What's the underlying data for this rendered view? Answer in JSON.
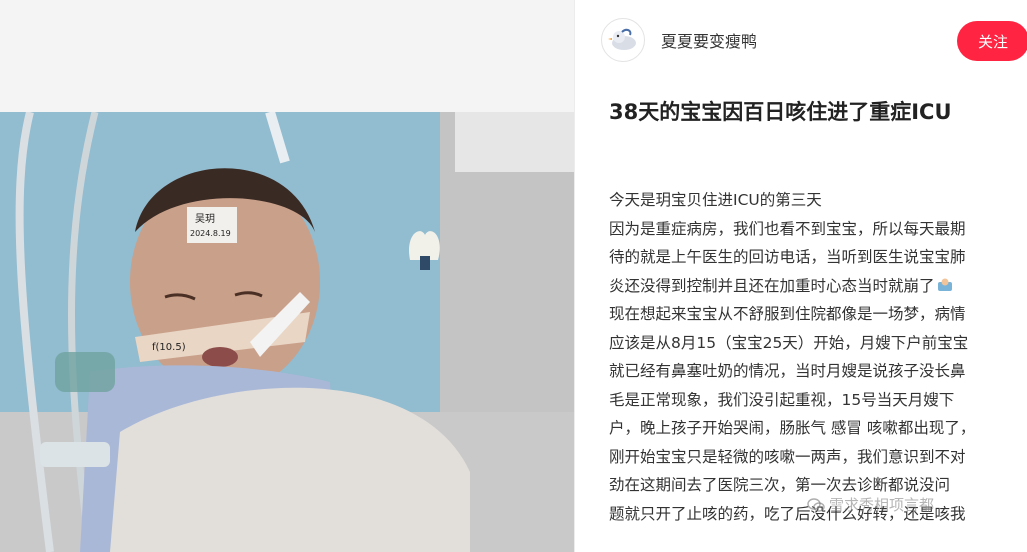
{
  "author": {
    "name": "夏夏要变瘦鸭",
    "avatar_icon": "duck-avatar-icon"
  },
  "follow_button": {
    "label": "关注",
    "color": "#ff2442"
  },
  "note": {
    "title": "38天的宝宝因百日咳住进了重症ICU",
    "lines": [
      "今天是玥宝贝住进ICU的第三天",
      "因为是重症病房，我们也看不到宝宝，所以每天最期",
      "待的就是上午医生的回访电话，当听到医生说宝宝肺",
      "炎还没得到控制并且还在加重时心态当时就崩了",
      "现在想起来宝宝从不舒服到住院都像是一场梦，病情",
      "应该是从8月15（宝宝25天）开始，月嫂下户前宝宝",
      "就已经有鼻塞吐奶的情况，当时月嫂是说孩子没长鼻",
      "毛是正常现象，我们没引起重视，15号当天月嫂下",
      "户，晚上孩子开始哭闹，肠胀气 感冒 咳嗽都出现了，",
      "刚开始宝宝只是轻微的咳嗽一两声，我们意识到不对",
      "劲在这期间去了医院三次，第一次去诊断都说没问",
      "题就只开了止咳的药，吃了后没什么好转，还是咳我"
    ]
  },
  "photo": {
    "forehead_label_1": "吴玥",
    "forehead_label_2": "2024.8.19",
    "cheek_label": "f(10.5)"
  },
  "watermark": {
    "text": "雪求秀相项言都"
  }
}
